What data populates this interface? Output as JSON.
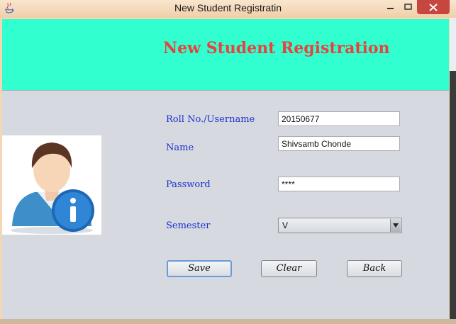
{
  "window": {
    "title": "New Student Registratin"
  },
  "header": {
    "title": "New Student Registration"
  },
  "form": {
    "roll_label": "Roll No./Username",
    "roll_value": "20150677",
    "name_label": "Name",
    "name_value": "Shivsamb Chonde",
    "password_label": "Password",
    "password_value": "****",
    "semester_label": "Semester",
    "semester_value": "V"
  },
  "buttons": {
    "save": "Save",
    "clear": "Clear",
    "back": "Back"
  },
  "colors": {
    "header_bg": "#32ffcf",
    "title_red": "#e8413e",
    "label_blue": "#1a33cc",
    "close_red": "#c7463f"
  },
  "icons": [
    "java-app-icon",
    "minimize-icon",
    "maximize-icon",
    "close-icon",
    "user-info-icon",
    "chevron-down-icon"
  ]
}
